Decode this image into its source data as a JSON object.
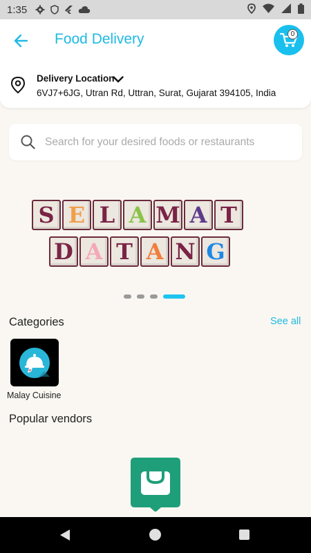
{
  "status_bar": {
    "time": "1:35",
    "icons": [
      "gear-icon",
      "shield-icon",
      "flutter-icon",
      "cloud-icon",
      "location-icon",
      "wifi-icon",
      "signal-icon",
      "battery-icon"
    ]
  },
  "app_bar": {
    "title": "Food Delivery",
    "cart_count": "0",
    "accent_color": "#1fb9e4",
    "cart_color": "#19c0ee"
  },
  "location": {
    "label": "Delivery Location",
    "address": "6VJ7+6JG, Utran Rd, Uttran, Surat, Gujarat 394105, India"
  },
  "search": {
    "placeholder": "Search for your desired foods or restaurants"
  },
  "banner": {
    "row1": [
      {
        "letter": "S",
        "color": "#7a2346"
      },
      {
        "letter": "E",
        "color": "#f0a04b"
      },
      {
        "letter": "L",
        "color": "#7a2346"
      },
      {
        "letter": "A",
        "color": "#8bc34a"
      },
      {
        "letter": "M",
        "color": "#7a2346"
      },
      {
        "letter": "A",
        "color": "#5e3a8c"
      },
      {
        "letter": "T",
        "color": "#7a2346"
      }
    ],
    "row2": [
      {
        "letter": "D",
        "color": "#7a2346"
      },
      {
        "letter": "A",
        "color": "#f4a8b8"
      },
      {
        "letter": "T",
        "color": "#7a2346"
      },
      {
        "letter": "A",
        "color": "#f07f3c"
      },
      {
        "letter": "N",
        "color": "#7a2346"
      },
      {
        "letter": "G",
        "color": "#1e88e5"
      }
    ],
    "page_count": 4,
    "active_page": 4
  },
  "categories": {
    "title": "Categories",
    "see_all": "See all",
    "items": [
      {
        "label": "Malay Cuisine",
        "icon": "food-cloche-icon"
      }
    ]
  },
  "popular_vendors": {
    "title": "Popular vendors",
    "empty_icon": "shopping-bag-icon",
    "empty_color": "#1f9e7a"
  },
  "nav_bar": {
    "buttons": [
      "back-icon",
      "home-icon",
      "recents-icon"
    ]
  }
}
